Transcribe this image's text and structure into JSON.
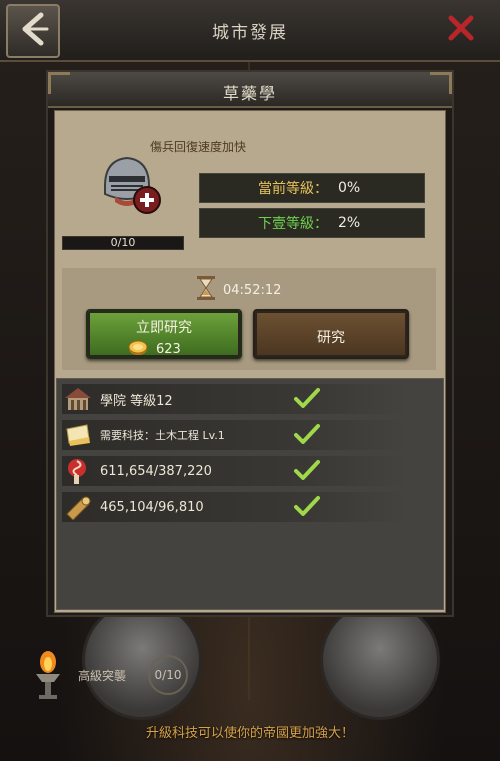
{
  "window": {
    "title": "城市發展"
  },
  "dialog": {
    "title": "草藥學",
    "description": "傷兵回復速度加快",
    "progress": {
      "text": "0/10",
      "fraction": 0.0
    },
    "current_level": {
      "label": "當前等級：",
      "value": "0%"
    },
    "next_level": {
      "label": "下壹等級：",
      "value": "2%"
    },
    "timer": "04:52:12",
    "instant_button": {
      "label": "立即研究",
      "cost": "623"
    },
    "research_button": {
      "label": "研究"
    },
    "requirements": [
      {
        "icon": "academy-icon",
        "text": "學院 等級12",
        "met": true
      },
      {
        "icon": "scroll-icon",
        "text": "需要科技：土木工程 Lv.1",
        "met": true
      },
      {
        "icon": "food-icon",
        "text": "611,654/387,220",
        "met": true
      },
      {
        "icon": "wood-icon",
        "text": "465,104/96,810",
        "met": true
      }
    ]
  },
  "background": {
    "upgrade_label": "高級突襲",
    "upgrade_count": "0/10",
    "footer_tip": "升級科技可以使你的帝國更加強大！"
  },
  "colors": {
    "instant_button": "#5b8f32",
    "research_button": "#5e4429",
    "current_level_label": "#e6c25a",
    "next_level_label": "#6fd04f",
    "close_icon": "#b8262a"
  }
}
